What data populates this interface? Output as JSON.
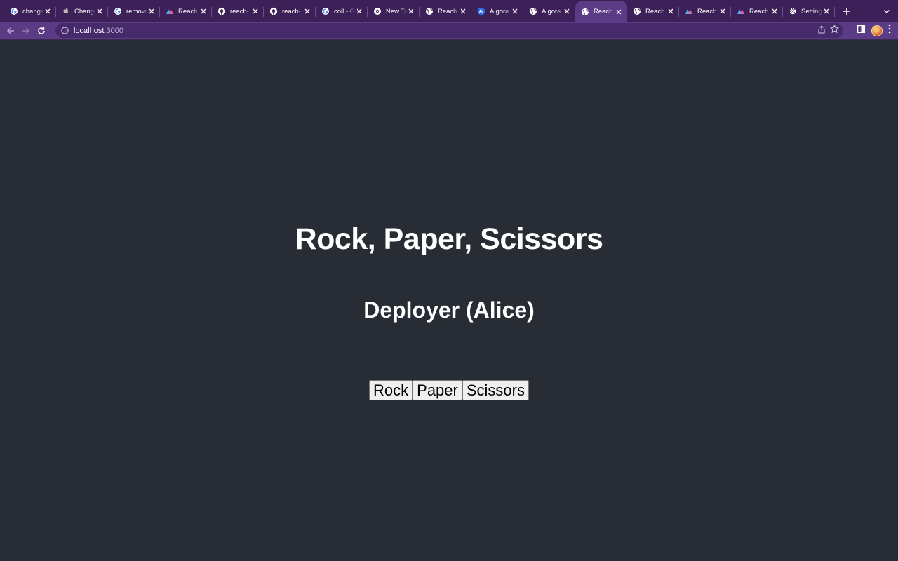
{
  "browser": {
    "tabs": [
      {
        "title": "change",
        "favicon": "google-icon"
      },
      {
        "title": "Change",
        "favicon": "apple-icon"
      },
      {
        "title": "remove",
        "favicon": "google-icon"
      },
      {
        "title": "Reach",
        "favicon": "reach-icon"
      },
      {
        "title": "reach-",
        "favicon": "github-icon"
      },
      {
        "title": "reach-",
        "favicon": "github-icon"
      },
      {
        "title": "coil - G",
        "favicon": "google-icon"
      },
      {
        "title": "New Ta",
        "favicon": "chrome-icon"
      },
      {
        "title": "Reach",
        "favicon": "globe-icon"
      },
      {
        "title": "Algora",
        "favicon": "algorand-icon"
      },
      {
        "title": "Algora",
        "favicon": "globe-icon"
      },
      {
        "title": "Reach",
        "favicon": "globe-icon",
        "active": true
      },
      {
        "title": "Reach",
        "favicon": "globe-icon"
      },
      {
        "title": "Reach",
        "favicon": "reach-icon"
      },
      {
        "title": "Reach",
        "favicon": "reach-icon"
      },
      {
        "title": "Setting",
        "favicon": "gear-icon"
      }
    ],
    "address": {
      "host": "localhost",
      "port": ":3000"
    }
  },
  "page": {
    "title": "Rock, Paper, Scissors",
    "subtitle": "Deployer (Alice)",
    "hands": [
      "Rock",
      "Paper",
      "Scissors"
    ]
  },
  "colors": {
    "page_background": "#282c34",
    "tabstrip": "#3c2057",
    "toolbar": "#5b3b85",
    "omnibox": "#472a6a",
    "text": "#ffffff"
  }
}
